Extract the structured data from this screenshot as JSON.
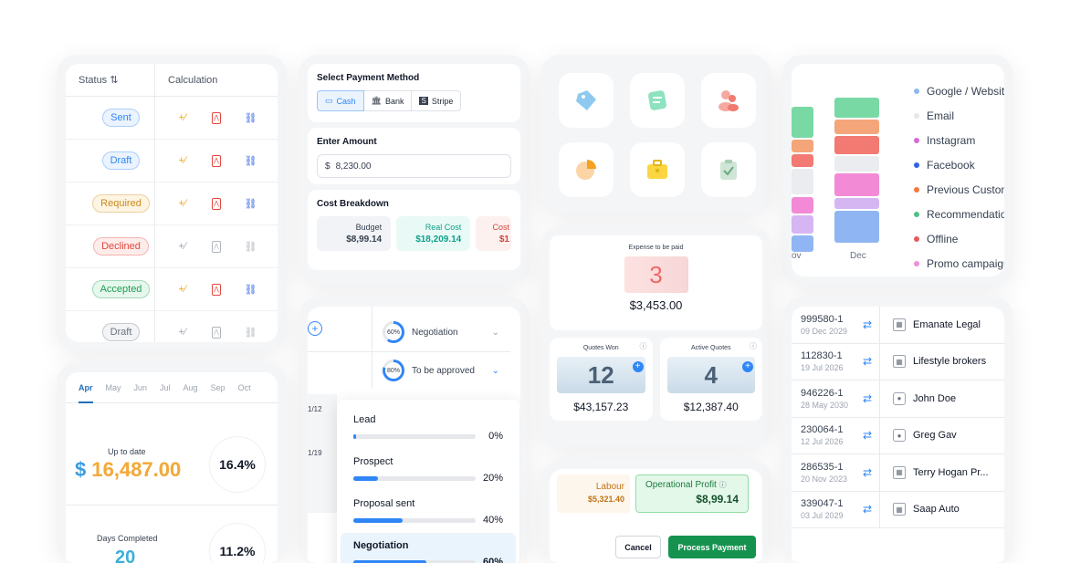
{
  "status_table": {
    "headers": {
      "status": "Status ⇅",
      "calculation": "Calculation"
    },
    "rows": [
      {
        "status": "Sent",
        "color": "#2f86f6"
      },
      {
        "status": "Draft",
        "color": "#2f86f6"
      },
      {
        "status": "Required",
        "color": "#c98a1b"
      },
      {
        "status": "Declined",
        "color": "#e0483e"
      },
      {
        "status": "Accepted",
        "color": "#1f9d55"
      },
      {
        "status": "Draft",
        "color": "#6b7280"
      }
    ]
  },
  "payment": {
    "method_label": "Select Payment Method",
    "methods": [
      "Cash",
      "Bank",
      "Stripe"
    ],
    "amount_label": "Enter Amount",
    "currency": "$",
    "amount_value": "8,230.00",
    "breakdown_label": "Cost Breakdown",
    "budget_label": "Budget",
    "budget_value": "$8,99.14",
    "real_label": "Real Cost",
    "real_value": "$18,209.14",
    "cost_label": "Cost",
    "cost_value": "$1"
  },
  "icons": [
    "tag-icon",
    "note-icon",
    "users-icon",
    "pie-chart-icon",
    "briefcase-icon",
    "clipboard-check-icon"
  ],
  "sources_chart": {
    "legend": [
      "Google / Website",
      "Email",
      "Instagram",
      "Facebook",
      "Previous Customer",
      "Recommendation",
      "Offline",
      "Promo campaign"
    ],
    "legend_colors": [
      "#8fb6f2",
      "#e5e7eb",
      "#d46bd8",
      "#2f62e6",
      "#f07a3a",
      "#4fbf86",
      "#e45b5b",
      "#f08ed6"
    ],
    "x_labels": [
      "ov",
      "Dec"
    ]
  },
  "funnel": {
    "rows": [
      {
        "pct": "60%",
        "label": "Negotiation"
      },
      {
        "pct": "80%",
        "label": "To be approved"
      }
    ],
    "dates": [
      "1/12",
      "1/19"
    ],
    "options": [
      {
        "label": "Lead",
        "value": 2,
        "pct": "0%"
      },
      {
        "label": "Prospect",
        "value": 20,
        "pct": "20%"
      },
      {
        "label": "Proposal sent",
        "value": 40,
        "pct": "40%"
      },
      {
        "label": "Negotiation",
        "value": 60,
        "pct": "60%"
      }
    ]
  },
  "expense": {
    "title": "Expense to be paid",
    "count": "3",
    "amount": "$3,453.00",
    "quotes_won_label": "Quotes Won",
    "quotes_won": "12",
    "quotes_won_amount": "$43,157.23",
    "active_label": "Active Quotes",
    "active": "4",
    "active_amount": "$12,387.40"
  },
  "profit": {
    "labour_label": "Labour",
    "labour_value": "$5,321.40",
    "op_label": "Operational Profit",
    "op_value": "$8,99.14",
    "cancel": "Cancel",
    "process": "Process Payment"
  },
  "clients": [
    {
      "id": "999580-1",
      "date": "09 Dec 2029",
      "name": "Emanate Legal",
      "type": "building"
    },
    {
      "id": "112830-1",
      "date": "19 Jul 2026",
      "name": "Lifestyle brokers",
      "type": "building"
    },
    {
      "id": "946226-1",
      "date": "28 May 2030",
      "name": "John Doe",
      "type": "person"
    },
    {
      "id": "230064-1",
      "date": "12 Jul 2026",
      "name": "Greg Gav",
      "type": "person"
    },
    {
      "id": "286535-1",
      "date": "20 Nov 2023",
      "name": "Terry Hogan Pr...",
      "type": "building"
    },
    {
      "id": "339047-1",
      "date": "03 Jul 2029",
      "name": "Saap Auto",
      "type": "building"
    }
  ],
  "progress": {
    "months": [
      "Apr",
      "May",
      "Jun",
      "Jul",
      "Aug",
      "Sep",
      "Oct"
    ],
    "uptodate_label": "Up to date",
    "uptodate_dollar": "$",
    "uptodate_value": "16,487.00",
    "uptodate_pct": "16.4%",
    "days_label": "Days Completed",
    "days_value": "20",
    "days_pct": "11.2%"
  }
}
